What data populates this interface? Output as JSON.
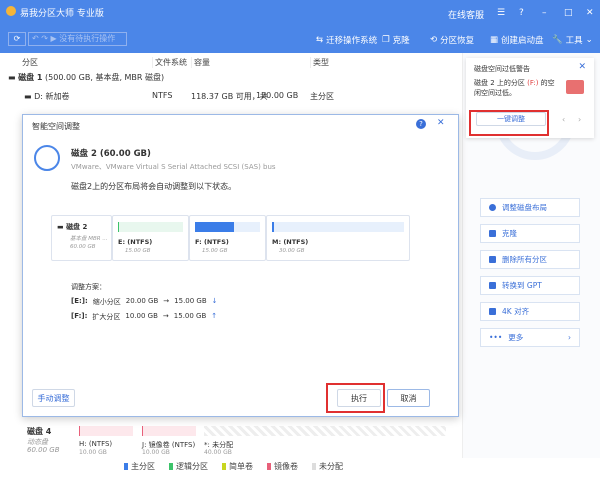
{
  "app": {
    "title": "易我分区大师 专业版",
    "online_service": "在线客服"
  },
  "toolbar": {
    "pending": "没有待执行操作",
    "migrate": "迁移操作系统",
    "clone": "克隆",
    "recover": "分区恢复",
    "bootable": "创建启动盘",
    "tools": "工具"
  },
  "columns": {
    "partition": "分区",
    "fs": "文件系统",
    "capacity": "容量",
    "type": "类型"
  },
  "disk1": {
    "name": "磁盘 1",
    "info": "(500.00 GB, 基本盘, MBR 磁盘)",
    "rows": [
      {
        "name": "D: 新加卷",
        "fs": "NTFS",
        "free": "118.37 GB 可用，共",
        "total": "120.00 GB",
        "type": "主分区"
      }
    ]
  },
  "dialog": {
    "title": "智能空间调整",
    "disk_title": "磁盘 2 (60.00 GB)",
    "disk_desc": "VMware、VMware Virtual S Serial Attached SCSI (SAS) bus",
    "intro": "磁盘2上的分区布局将会自动调整到以下状态。",
    "map": {
      "disk": "磁盘 2",
      "disk_type": "基本盘 MBR ...",
      "disk_size": "60.00 GB",
      "parts": [
        {
          "label": "E: (NTFS)",
          "size": "15.00 GB",
          "fill": 0.02,
          "color": "#3cc36a",
          "bg": "#e8f7ee"
        },
        {
          "label": "F: (NTFS)",
          "size": "15.00 GB",
          "fill": 0.6,
          "color": "#3b7de8",
          "bg": "#e7f0fc"
        },
        {
          "label": "M: (NTFS)",
          "size": "30.00 GB",
          "fill": 0.01,
          "color": "#3b7de8",
          "bg": "#e7f0fc"
        }
      ]
    },
    "plan_title": "调整方案：",
    "plan": [
      {
        "part": "[E:]:",
        "action": "缩小分区",
        "from": "20.00 GB",
        "to": "15.00 GB",
        "arrow": "↓"
      },
      {
        "part": "[F:]:",
        "action": "扩大分区",
        "from": "10.00 GB",
        "to": "15.00 GB",
        "arrow": "↑"
      }
    ],
    "manual": "手动调整",
    "execute": "执行",
    "cancel": "取消"
  },
  "disk4": {
    "name": "磁盘 4",
    "type": "动态盘",
    "size": "60.00 GB",
    "parts": [
      {
        "label": "H: (NTFS)",
        "size": "10.00 GB"
      },
      {
        "label": "J: 镜像卷 (NTFS)",
        "size": "10.00 GB"
      },
      {
        "label": "*: 未分配",
        "size": "40.00 GB"
      }
    ]
  },
  "legend": [
    {
      "label": "主分区",
      "color": "#3b7de8"
    },
    {
      "label": "逻辑分区",
      "color": "#3cc36a"
    },
    {
      "label": "简单卷",
      "color": "#c8d620"
    },
    {
      "label": "镜像卷",
      "color": "#e8607a"
    },
    {
      "label": "未分配",
      "color": "#dddddd"
    }
  ],
  "warning": {
    "title": "磁盘空间过低警告",
    "text_pre": "磁盘 2 上的分区 ",
    "part": "(F:)",
    "text_post": " 的空闲空间过低。",
    "button": "一键调整"
  },
  "side": [
    "调整磁盘布局",
    "克隆",
    "删除所有分区",
    "转换到 GPT",
    "4K 对齐",
    "更多"
  ]
}
